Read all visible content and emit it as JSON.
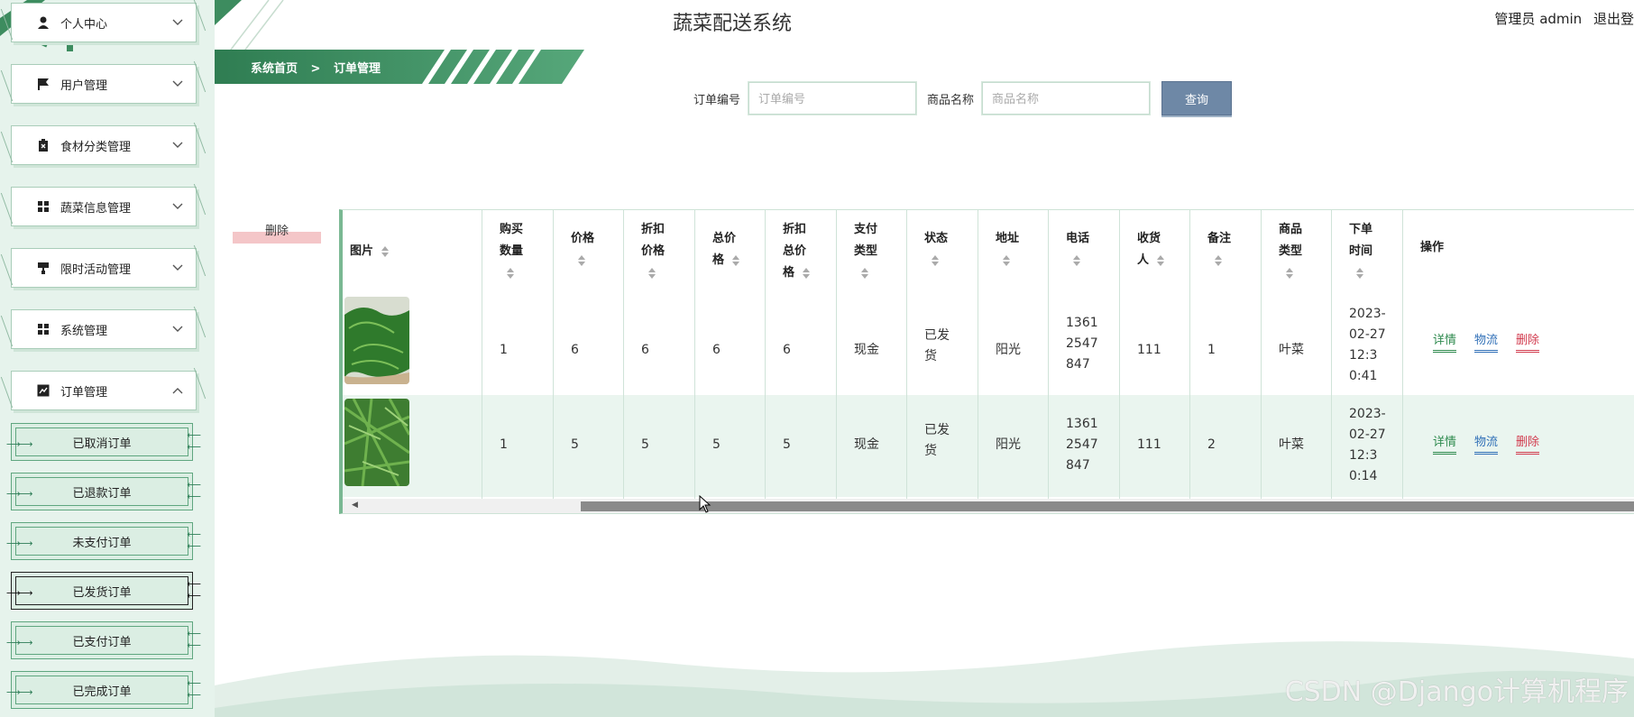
{
  "app": {
    "title": "蔬菜配送系统"
  },
  "user_bar": {
    "role_user": "管理员 admin",
    "logout": "退出登"
  },
  "breadcrumb": {
    "home": "系统首页",
    "separator": ">",
    "current": "订单管理"
  },
  "sidebar": {
    "items": [
      {
        "label": "个人中心",
        "icon": "user-icon",
        "expanded": false
      },
      {
        "label": "用户管理",
        "icon": "flag-icon",
        "expanded": false
      },
      {
        "label": "食材分类管理",
        "icon": "clipboard-icon",
        "expanded": false
      },
      {
        "label": "蔬菜信息管理",
        "icon": "grid-icon",
        "expanded": false
      },
      {
        "label": "限时活动管理",
        "icon": "paint-roller-icon",
        "expanded": false
      },
      {
        "label": "系统管理",
        "icon": "grid-icon",
        "expanded": false
      },
      {
        "label": "订单管理",
        "icon": "chart-icon",
        "expanded": true
      }
    ],
    "sub_items": [
      {
        "label": "已取消订单"
      },
      {
        "label": "已退款订单"
      },
      {
        "label": "未支付订单"
      },
      {
        "label": "已发货订单",
        "active": true
      },
      {
        "label": "已支付订单"
      },
      {
        "label": "已完成订单"
      }
    ]
  },
  "search": {
    "order_no_label": "订单编号",
    "order_no_placeholder": "订单编号",
    "product_label": "商品名称",
    "product_placeholder": "商品名称",
    "button": "查询"
  },
  "toolbar": {
    "delete_label": "删除"
  },
  "table": {
    "headers": {
      "image": "图片",
      "qty_1": "购买",
      "qty_2": "数量",
      "price": "价格",
      "disc_price_1": "折扣",
      "disc_price_2": "价格",
      "total_1": "总价",
      "total_2": "格",
      "disc_total_1": "折扣",
      "disc_total_2": "总价",
      "disc_total_3": "格",
      "paytype_1": "支付",
      "paytype_2": "类型",
      "status": "状态",
      "address": "地址",
      "phone": "电话",
      "receiver_1": "收货",
      "receiver_2": "人",
      "remark": "备注",
      "ptype_1": "商品",
      "ptype_2": "类型",
      "time_1": "下单",
      "time_2": "时间",
      "actions": "操作"
    },
    "rows": [
      {
        "image": "spinach-photo",
        "qty": "1",
        "price": "6",
        "disc_price": "6",
        "total": "6",
        "disc_total": "6",
        "pay_type": "现金",
        "status_1": "已发",
        "status_2": "货",
        "address": "阳光",
        "phone_1": "1361",
        "phone_2": "2547",
        "phone_3": "847",
        "receiver": "111",
        "remark": "1",
        "product_type": "叶菜",
        "time_1": "2023-",
        "time_2": "02-27",
        "time_3": "12:3",
        "time_4": "0:41",
        "detail": "详情",
        "logistics": "物流",
        "delete": "删除"
      },
      {
        "image": "arugula-photo",
        "qty": "1",
        "price": "5",
        "disc_price": "5",
        "total": "5",
        "disc_total": "5",
        "pay_type": "现金",
        "status_1": "已发",
        "status_2": "货",
        "address": "阳光",
        "phone_1": "1361",
        "phone_2": "2547",
        "phone_3": "847",
        "receiver": "111",
        "remark": "2",
        "product_type": "叶菜",
        "time_1": "2023-",
        "time_2": "02-27",
        "time_3": "12:3",
        "time_4": "0:14",
        "detail": "详情",
        "logistics": "物流",
        "delete": "删除"
      }
    ]
  },
  "watermark": "CSDN @Django计算机程序",
  "colors": {
    "accent": "#3d8c5f",
    "sidebar_bg": "#e6f3ec",
    "search_btn": "#6e88a6",
    "delete": "#d23b4e",
    "logistics": "#2f6fb7",
    "detail": "#2e8a4e"
  }
}
